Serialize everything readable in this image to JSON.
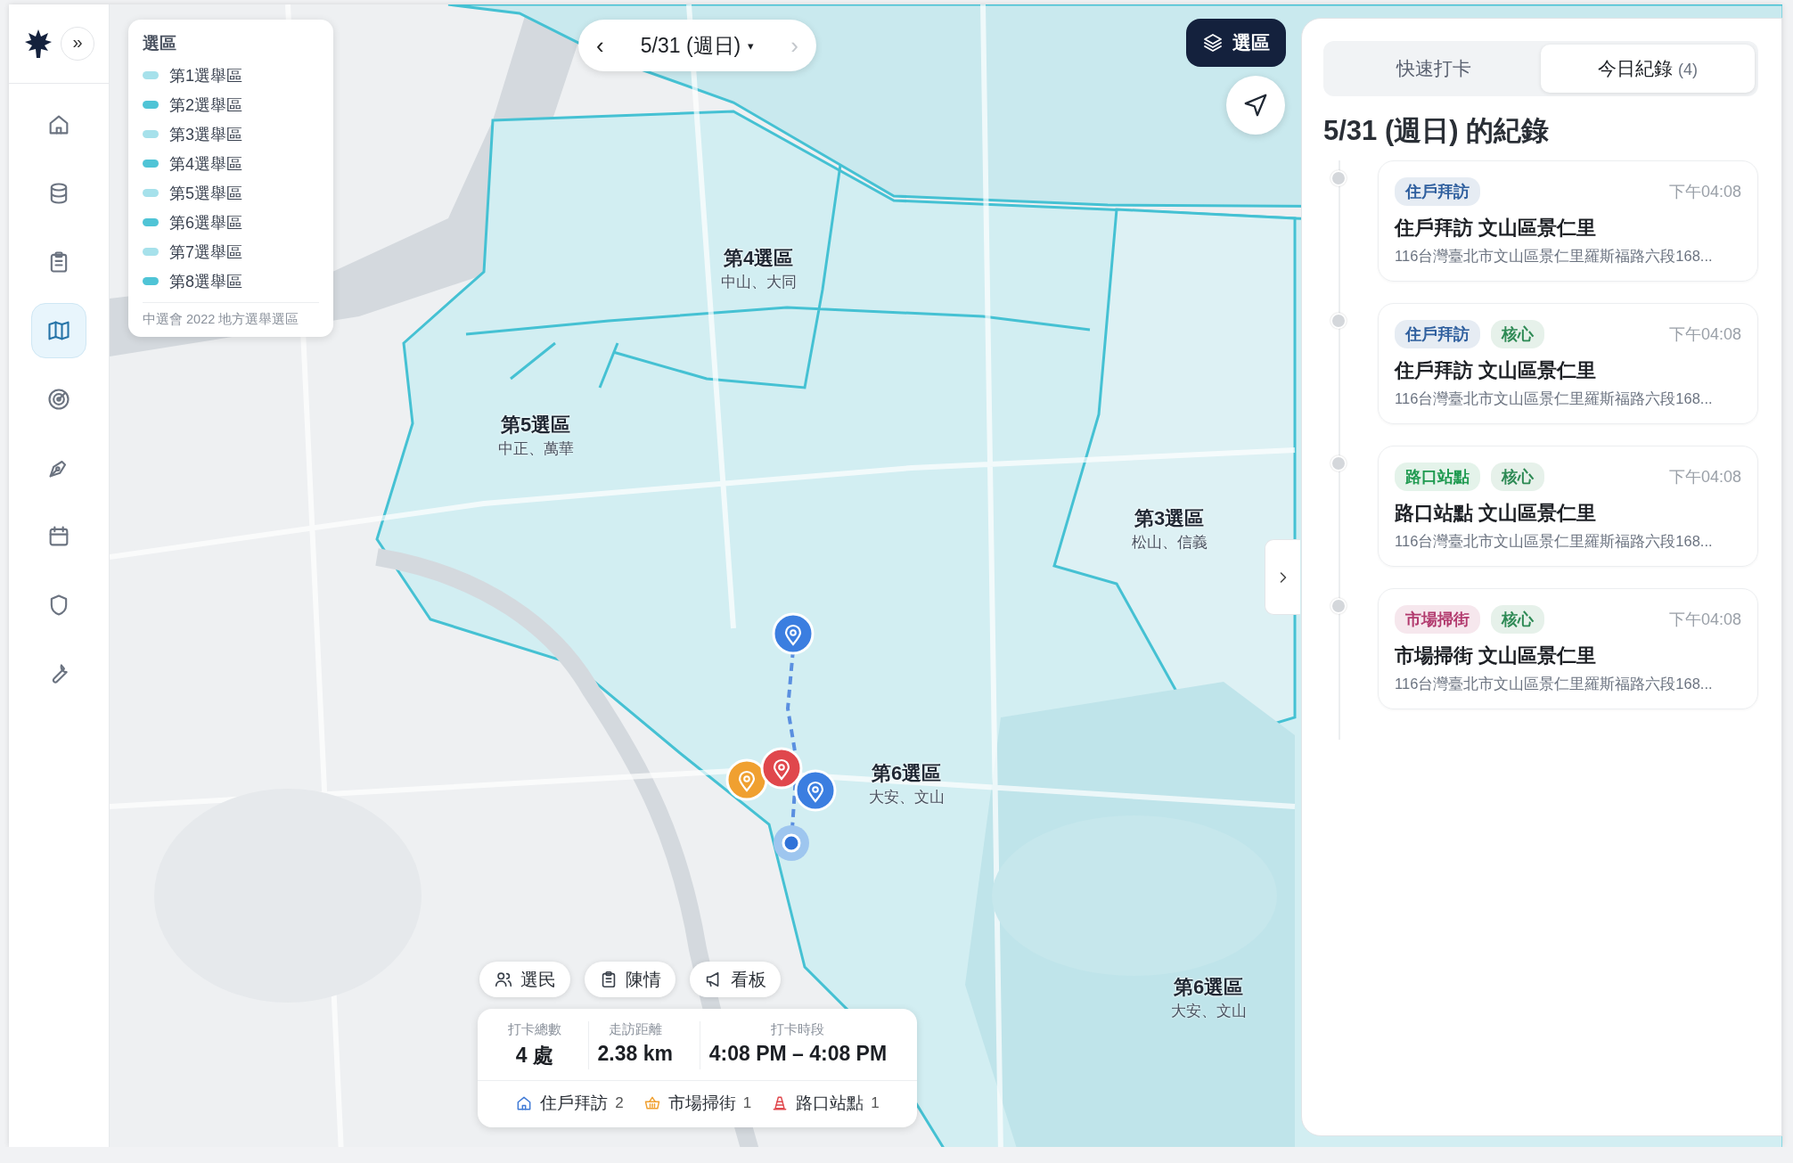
{
  "sidebar": {
    "expand_label": "»",
    "items": [
      {
        "kind": "home",
        "selected": false
      },
      {
        "kind": "database",
        "selected": false
      },
      {
        "kind": "clipboard",
        "selected": false
      },
      {
        "kind": "map",
        "selected": true
      },
      {
        "kind": "radar",
        "selected": false
      },
      {
        "kind": "pen",
        "selected": false
      },
      {
        "kind": "calendar",
        "selected": false
      },
      {
        "kind": "shield",
        "selected": false
      },
      {
        "kind": "wrench",
        "selected": false
      }
    ]
  },
  "legend": {
    "title": "選區",
    "items": [
      {
        "label": "第1選舉區",
        "color": "#a6e1eb"
      },
      {
        "label": "第2選舉區",
        "color": "#4fc4d6"
      },
      {
        "label": "第3選舉區",
        "color": "#a6e1eb"
      },
      {
        "label": "第4選舉區",
        "color": "#4fc4d6"
      },
      {
        "label": "第5選舉區",
        "color": "#a6e1eb"
      },
      {
        "label": "第6選舉區",
        "color": "#4fc4d6"
      },
      {
        "label": "第7選舉區",
        "color": "#a6e1eb"
      },
      {
        "label": "第8選舉區",
        "color": "#4fc4d6"
      }
    ],
    "source": "中選會 2022 地方選舉選區"
  },
  "date_picker": {
    "prev": "‹",
    "label": "5/31 (週日)",
    "caret": "▾",
    "next": "›",
    "next_disabled": true
  },
  "layer_button": {
    "label": "選區"
  },
  "districts": [
    {
      "name": "第4選區",
      "areas": "中山、大同"
    },
    {
      "name": "第5選區",
      "areas": "中正、萬華"
    },
    {
      "name": "第3選區",
      "areas": "松山、信義"
    },
    {
      "name": "第6選區",
      "areas": "大安、文山"
    },
    {
      "name": "第6選區",
      "areas": "大安、文山"
    }
  ],
  "markers": [
    {
      "color": "#3b7ee0"
    },
    {
      "color": "#f0a030"
    },
    {
      "color": "#e0474c"
    },
    {
      "color": "#3b7ee0"
    }
  ],
  "chips": [
    {
      "kind": "people",
      "label": "選民"
    },
    {
      "kind": "clipboard",
      "label": "陳情"
    },
    {
      "kind": "megaphone",
      "label": "看板"
    }
  ],
  "stats": {
    "items": [
      {
        "label": "打卡總數",
        "value": "4 處"
      },
      {
        "label": "走訪距離",
        "value": "2.38 km"
      },
      {
        "label": "打卡時段",
        "value": "4:08 PM – 4:08 PM"
      }
    ],
    "counts": [
      {
        "kind": "home",
        "label": "住戶拜訪",
        "count": "2"
      },
      {
        "kind": "basket",
        "label": "市場掃街",
        "count": "1"
      },
      {
        "kind": "cone",
        "label": "路口站點",
        "count": "1"
      }
    ]
  },
  "panel": {
    "tabs": [
      {
        "label": "快速打卡",
        "selected": false
      },
      {
        "label": "今日紀錄",
        "count": "(4)",
        "selected": true
      }
    ],
    "heading": "5/31 (週日) 的紀錄",
    "records": [
      {
        "tags": [
          {
            "label": "住戶拜訪",
            "color": "#2f5f9e"
          }
        ],
        "time": "下午04:08",
        "title": "住戶拜訪 文山區景仁里",
        "address": "116台灣臺北市文山區景仁里羅斯福路六段168..."
      },
      {
        "tags": [
          {
            "label": "住戶拜訪",
            "color": "#2f5f9e"
          },
          {
            "label": "核心",
            "color": "#2e8a55"
          }
        ],
        "time": "下午04:08",
        "title": "住戶拜訪 文山區景仁里",
        "address": "116台灣臺北市文山區景仁里羅斯福路六段168..."
      },
      {
        "tags": [
          {
            "label": "路口站點",
            "color": "#1f9a50"
          },
          {
            "label": "核心",
            "color": "#2e8a55"
          }
        ],
        "time": "下午04:08",
        "title": "路口站點 文山區景仁里",
        "address": "116台灣臺北市文山區景仁里羅斯福路六段168..."
      },
      {
        "tags": [
          {
            "label": "市場掃街",
            "color": "#b23a6e"
          },
          {
            "label": "核心",
            "color": "#2e8a55"
          }
        ],
        "time": "下午04:08",
        "title": "市場掃街 文山區景仁里",
        "address": "116台灣臺北市文山區景仁里羅斯福路六段168..."
      }
    ]
  }
}
